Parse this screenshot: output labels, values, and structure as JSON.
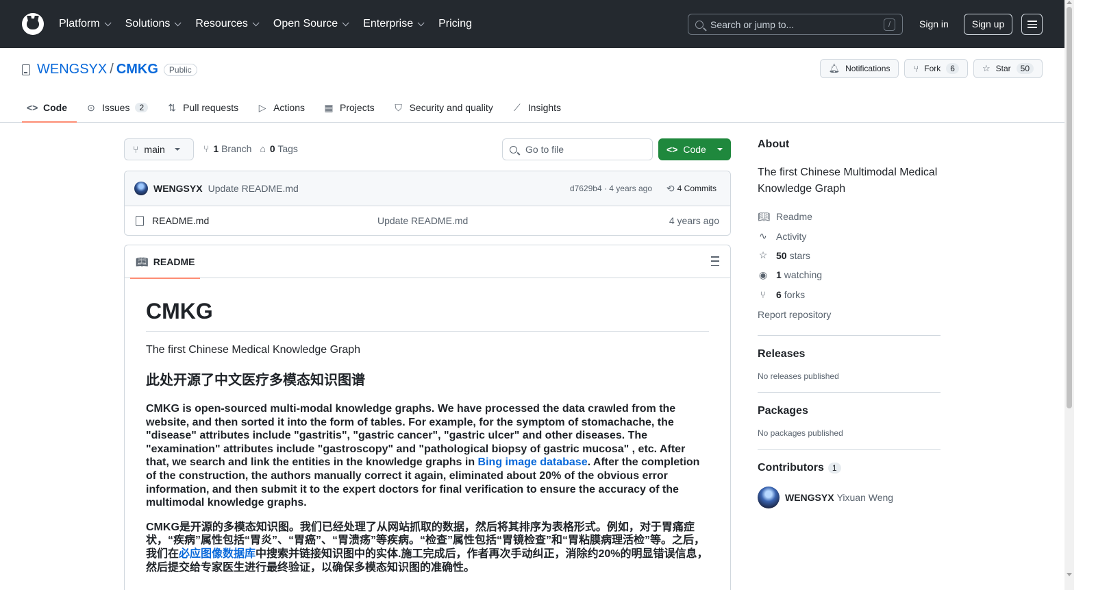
{
  "header": {
    "nav": [
      {
        "label": "Platform",
        "dropdown": true
      },
      {
        "label": "Solutions",
        "dropdown": true
      },
      {
        "label": "Resources",
        "dropdown": true
      },
      {
        "label": "Open Source",
        "dropdown": true
      },
      {
        "label": "Enterprise",
        "dropdown": true
      },
      {
        "label": "Pricing",
        "dropdown": false
      }
    ],
    "search_placeholder": "Search or jump to...",
    "search_shortcut": "/",
    "signin": "Sign in",
    "signup": "Sign up"
  },
  "repo": {
    "owner": "WENGSYX",
    "separator": "/",
    "name": "CMKG",
    "visibility": "Public",
    "notifications": "Notifications",
    "fork_label": "Fork",
    "fork_count": "6",
    "star_label": "Star",
    "star_count": "50"
  },
  "tabs": [
    {
      "label": "Code",
      "icon": "code-icon"
    },
    {
      "label": "Issues",
      "icon": "issue-icon",
      "count": "2"
    },
    {
      "label": "Pull requests",
      "icon": "pull-request-icon"
    },
    {
      "label": "Actions",
      "icon": "play-icon"
    },
    {
      "label": "Projects",
      "icon": "table-icon"
    },
    {
      "label": "Security and quality",
      "icon": "shield-icon"
    },
    {
      "label": "Insights",
      "icon": "graph-icon"
    }
  ],
  "toolbar": {
    "branch": "main",
    "branch_count": "1",
    "branch_label": "Branch",
    "tag_count": "0",
    "tag_label": "Tags",
    "goto_placeholder": "Go to file",
    "code_button": "Code"
  },
  "commit": {
    "author": "WENGSYX",
    "message": "Update README.md",
    "meta": "d7629b4 · 4 years ago",
    "commits": "4 Commits"
  },
  "files": [
    {
      "name": "README.md",
      "commit": "Update README.md",
      "age": "4 years ago"
    }
  ],
  "readme": {
    "tab_label": "README",
    "title": "CMKG",
    "subtitle": "The first Chinese Medical Knowledge Graph",
    "heading_cn": "此处开源了中文医疗多模态知识图谱",
    "para_en_1": "CMKG is open-sourced multi-modal knowledge graphs. We have processed the data crawled from the website, and then sorted it into the form of tables. For example, for the symptom of stomachache, the \"disease\" attributes include \"gastritis\", \"gastric cancer\", \"gastric ulcer\" and other diseases. The \"examination\" attributes include \"gastroscopy\" and \"pathological biopsy of gastric mucosa\" , etc. After that, we search and link the entities in the knowledge graphs in ",
    "para_en_link": "Bing image database",
    "para_en_2": ". After the completion of the construction, the authors manually correct it again, eliminated about 20% of the obvious error information, and then submit it to the expert doctors for final verification to ensure the accuracy of the multimodal knowledge graphs.",
    "para_cn_1": "CMKG是开源的多模态知识图。我们已经处理了从网站抓取的数据，然后将其排序为表格形式。例如，对于胃痛症状，“疾病”属性包括“胃炎”、“胃癌”、“胃溃疡”等疾病。“检查”属性包括“胃镜检查”和“胃粘膜病理活检”等。之后，我们在",
    "para_cn_link": "必应图像数据库",
    "para_cn_2": "中搜索并链接知识图中的实体.施工完成后，作者再次手动纠正，消除约20%的明显错误信息，然后提交给专家医生进行最终验证，以确保多模态知识图的准确性。"
  },
  "about": {
    "heading": "About",
    "description": "The first Chinese Multimodal Medical Knowledge Graph",
    "readme": "Readme",
    "activity": "Activity",
    "stars_count": "50",
    "stars_label": "stars",
    "watching_count": "1",
    "watching_label": "watching",
    "forks_count": "6",
    "forks_label": "forks",
    "report": "Report repository"
  },
  "releases": {
    "heading": "Releases",
    "note": "No releases published"
  },
  "packages": {
    "heading": "Packages",
    "note": "No packages published"
  },
  "contributors": {
    "heading": "Contributors",
    "count": "1",
    "list": [
      {
        "login": "WENGSYX",
        "name": "Yixuan Weng"
      }
    ]
  }
}
